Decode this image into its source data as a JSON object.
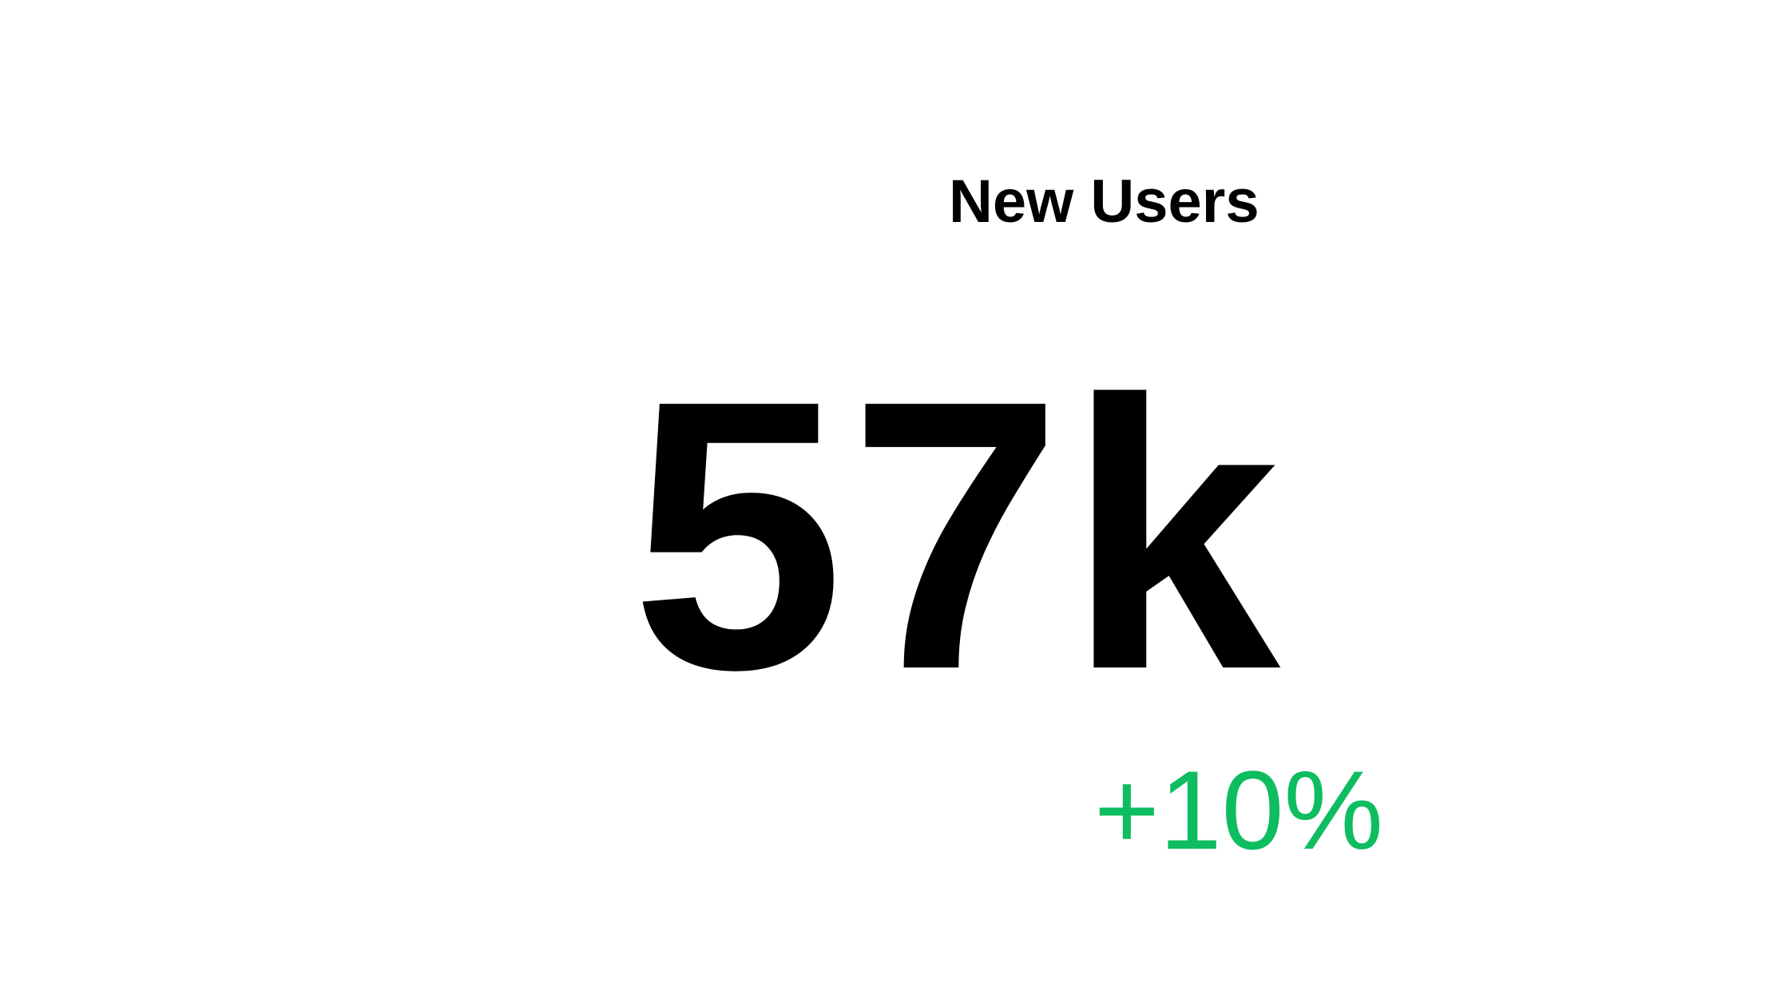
{
  "kpi": {
    "title": "New Users",
    "value": "57k",
    "change": "+10%"
  },
  "colors": {
    "background": "#ffffff",
    "text": "#000000",
    "positive": "#0dbd5f"
  }
}
